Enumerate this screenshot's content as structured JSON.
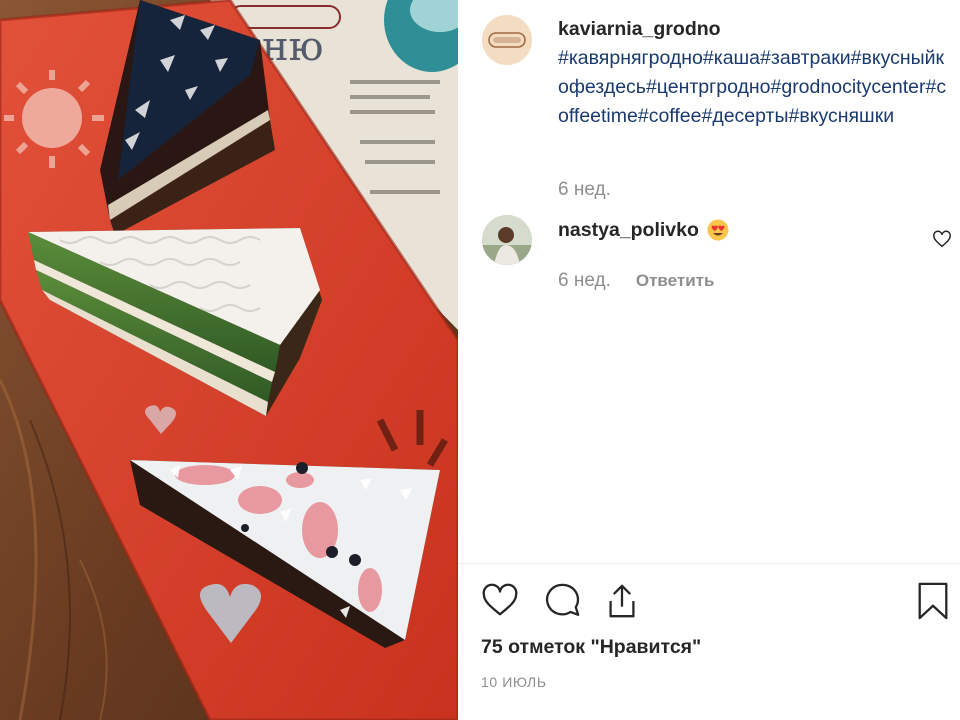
{
  "post": {
    "image_alt": "three slices of cake on an orange plate",
    "author": {
      "username": "kaviarnia_grodno",
      "avatar_logo_text": "КАВЯРНЯ",
      "hashtags": "#кавярнягродно#каша#завтраки#вкусныйкофездесь#центргродно#grodnocitycenter#coffeetime#coffee#десерты#вкусняшки"
    },
    "caption_time": "6 нед."
  },
  "comments": [
    {
      "username": "nastya_polivko",
      "emoji": "heart-eyes-emoji",
      "time": "6 нед.",
      "reply_label": "Ответить"
    }
  ],
  "footer": {
    "likes_text": "75 отметок \"Нравится\"",
    "date_text": "10 ИЮЛЬ"
  },
  "colors": {
    "hashtag": "#1a3a6e",
    "muted": "#8e8e8e",
    "text": "#262626",
    "plate": "#e0432b",
    "emoji_heart": "#e8332f"
  }
}
